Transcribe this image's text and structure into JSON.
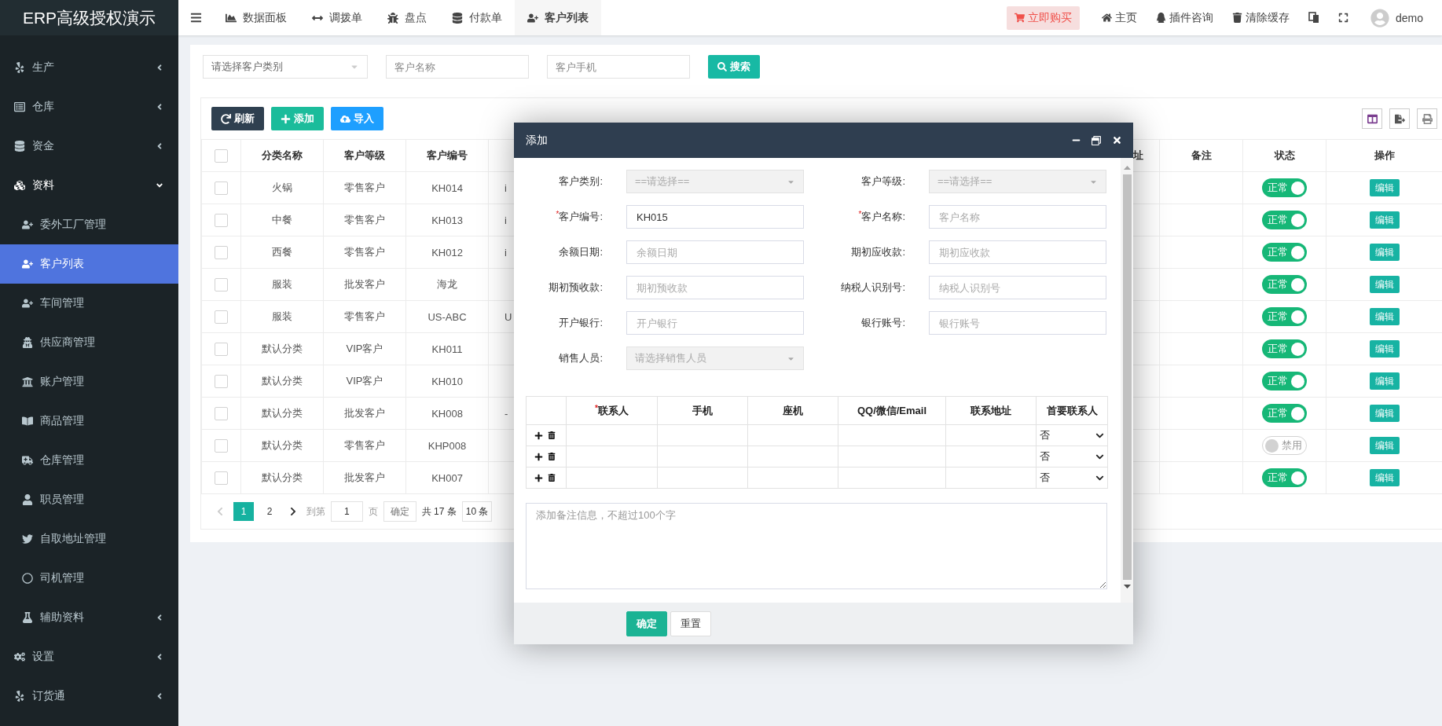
{
  "brand": "ERP高级授权演示",
  "sidebar": {
    "items": [
      {
        "label": "生产",
        "selected": false,
        "expanded": false
      },
      {
        "label": "仓库",
        "selected": false,
        "expanded": false
      },
      {
        "label": "资金",
        "selected": false,
        "expanded": false
      },
      {
        "label": "资料",
        "selected": false,
        "expanded": true,
        "children": [
          {
            "label": "委外工厂管理",
            "selected": false
          },
          {
            "label": "客户列表",
            "selected": true
          },
          {
            "label": "车间管理",
            "selected": false
          },
          {
            "label": "供应商管理",
            "selected": false
          },
          {
            "label": "账户管理",
            "selected": false
          },
          {
            "label": "商品管理",
            "selected": false
          },
          {
            "label": "仓库管理",
            "selected": false
          },
          {
            "label": "职员管理",
            "selected": false
          },
          {
            "label": "自取地址管理",
            "selected": false
          },
          {
            "label": "司机管理",
            "selected": false
          },
          {
            "label": "辅助资料",
            "selected": false,
            "expanded": false
          }
        ]
      },
      {
        "label": "设置",
        "selected": false,
        "expanded": false
      },
      {
        "label": "订货通",
        "selected": false,
        "expanded": false
      }
    ]
  },
  "tabs": [
    {
      "label": "数据面板",
      "selected": false
    },
    {
      "label": "调拨单",
      "selected": false
    },
    {
      "label": "盘点",
      "selected": false
    },
    {
      "label": "付款单",
      "selected": false
    },
    {
      "label": "客户列表",
      "selected": true
    }
  ],
  "header_actions": {
    "buy": "立即购买",
    "links": [
      "主页",
      "插件咨询",
      "清除缓存"
    ],
    "user": "demo"
  },
  "filters": {
    "category_select": "请选择客户类别",
    "name_placeholder": "客户名称",
    "phone_placeholder": "客户手机",
    "search": "搜索"
  },
  "toolbar": [
    "刷新",
    "添加",
    "导入"
  ],
  "table": {
    "all_checked": false,
    "columns": [
      {
        "label": "分类名称",
        "kind": "text"
      },
      {
        "label": "客户等级",
        "kind": "text"
      },
      {
        "label": "客户编号",
        "kind": "text"
      },
      {
        "kind": "cut_left"
      },
      {
        "label": "址",
        "kind": "cut_right"
      },
      {
        "label": "备注",
        "kind": "text"
      },
      {
        "label": "状态",
        "kind": "status"
      },
      {
        "label": "操作",
        "kind": "action"
      }
    ],
    "rows": [
      {
        "checked": false,
        "cells": [
          "火锅",
          "零售客户",
          "KH014",
          "i"
        ],
        "status": {
          "label": "正常",
          "on": true
        },
        "action": "编辑"
      },
      {
        "checked": false,
        "cells": [
          "中餐",
          "零售客户",
          "KH013",
          "i"
        ],
        "status": {
          "label": "正常",
          "on": true
        },
        "action": "编辑"
      },
      {
        "checked": false,
        "cells": [
          "西餐",
          "零售客户",
          "KH012",
          "i"
        ],
        "status": {
          "label": "正常",
          "on": true
        },
        "action": "编辑"
      },
      {
        "checked": false,
        "cells": [
          "服装",
          "批发客户",
          "海龙"
        ],
        "status": {
          "label": "正常",
          "on": true
        },
        "action": "编辑"
      },
      {
        "checked": false,
        "cells": [
          "服装",
          "零售客户",
          "US-ABC",
          "U"
        ],
        "status": {
          "label": "正常",
          "on": true
        },
        "action": "编辑"
      },
      {
        "checked": false,
        "cells": [
          "默认分类",
          "VIP客户",
          "KH011"
        ],
        "status": {
          "label": "正常",
          "on": true
        },
        "action": "编辑"
      },
      {
        "checked": false,
        "cells": [
          "默认分类",
          "VIP客户",
          "KH010"
        ],
        "status": {
          "label": "正常",
          "on": true
        },
        "action": "编辑"
      },
      {
        "checked": false,
        "cells": [
          "默认分类",
          "批发客户",
          "KH008",
          "-"
        ],
        "status": {
          "label": "正常",
          "on": true
        },
        "action": "编辑"
      },
      {
        "checked": false,
        "cells": [
          "默认分类",
          "零售客户",
          "KHP008"
        ],
        "status": {
          "label": "禁用",
          "on": false
        },
        "action": "编辑"
      },
      {
        "checked": false,
        "cells": [
          "默认分类",
          "批发客户",
          "KH007"
        ],
        "status": {
          "label": "正常",
          "on": true
        },
        "action": "编辑"
      }
    ]
  },
  "pagination": {
    "pages": [
      {
        "label": "1",
        "selected": true
      },
      {
        "label": "2",
        "selected": false
      }
    ],
    "goto_label": "到第",
    "goto_value": "1",
    "page_unit": "页",
    "confirm": "确定",
    "total": "共 17 条",
    "page_size": "10 条"
  },
  "dialog": {
    "title": "添加",
    "fields": [
      {
        "kind": "select",
        "label": "客户类别:",
        "placeholder": "==请选择=="
      },
      {
        "kind": "select",
        "label": "客户等级:",
        "placeholder": "==请选择=="
      },
      {
        "kind": "input",
        "label": "客户编号:",
        "mark": "*",
        "value": "KH015"
      },
      {
        "kind": "input",
        "label": "客户名称:",
        "mark": "*",
        "placeholder": "客户名称"
      },
      {
        "kind": "input",
        "label": "余额日期:",
        "placeholder": "余额日期"
      },
      {
        "kind": "input",
        "label": "期初应收款:",
        "placeholder": "期初应收款"
      },
      {
        "kind": "input",
        "label": "期初预收款:",
        "placeholder": "期初预收款"
      },
      {
        "kind": "input",
        "label": "纳税人识别号:",
        "placeholder": "纳税人识别号"
      },
      {
        "kind": "input",
        "label": "开户银行:",
        "placeholder": "开户银行"
      },
      {
        "kind": "input",
        "label": "银行账号:",
        "placeholder": "银行账号"
      },
      {
        "kind": "select",
        "label": "销售人员:",
        "placeholder": "请选择销售人员"
      }
    ],
    "contacts": {
      "columns": [
        {
          "label": "联系人",
          "mark": "*"
        },
        {
          "label": "手机"
        },
        {
          "label": "座机"
        },
        {
          "label": "QQ/微信/Email"
        },
        {
          "label": "联系地址"
        },
        {
          "label": "首要联系人"
        }
      ],
      "rows": [
        {
          "primary": "否"
        },
        {
          "primary": "否"
        },
        {
          "primary": "否"
        }
      ]
    },
    "remark_placeholder": "添加备注信息，不超过100个字",
    "buttons": [
      "确定",
      "重置"
    ]
  }
}
